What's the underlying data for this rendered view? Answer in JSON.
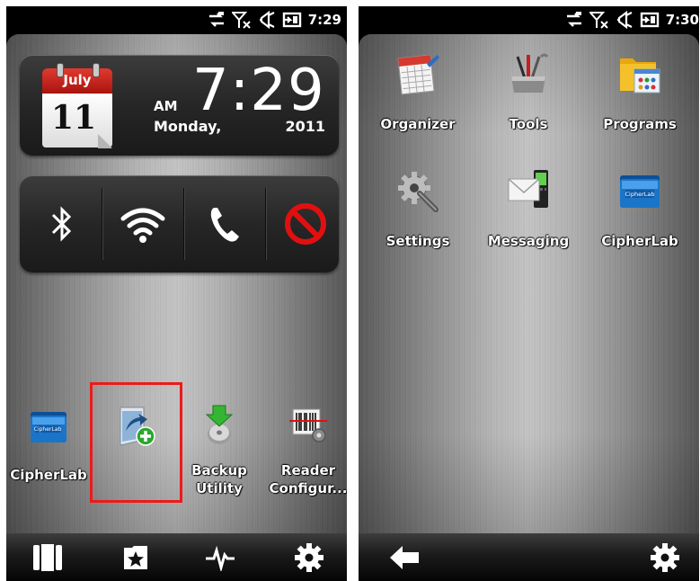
{
  "left_screen": {
    "status": {
      "time": "7:29"
    },
    "clock": {
      "month": "July",
      "day": "11",
      "ampm": "AM",
      "time": "7:29",
      "weekday": "Monday,",
      "year": "2011"
    },
    "connectivity": [
      "bluetooth",
      "wifi",
      "phone",
      "disabled"
    ],
    "apps": [
      {
        "label_line1": "CipherLab",
        "label_line2": "",
        "icon": "cipherlab-folder-icon"
      },
      {
        "label_line1": "",
        "label_line2": "",
        "icon": "add-shortcut-icon"
      },
      {
        "label_line1": "Backup",
        "label_line2": "Utility",
        "icon": "backup-utility-icon"
      },
      {
        "label_line1": "Reader",
        "label_line2": "Configur...",
        "icon": "barcode-reader-icon"
      }
    ],
    "taskbar": [
      "start-tiles-icon",
      "favorites-icon",
      "activity-icon",
      "settings-gear-icon"
    ]
  },
  "right_screen": {
    "status": {
      "time": "7:30"
    },
    "apps": [
      {
        "label": "Organizer",
        "icon": "calendar-organizer-icon"
      },
      {
        "label": "Tools",
        "icon": "tools-icon"
      },
      {
        "label": "Programs",
        "icon": "programs-folder-icon"
      },
      {
        "label": "Settings",
        "icon": "settings-icon"
      },
      {
        "label": "Messaging",
        "icon": "messaging-icon"
      },
      {
        "label": "CipherLab",
        "icon": "cipherlab-folder-icon"
      }
    ],
    "taskbar": [
      "back-arrow-icon",
      "settings-gear-icon"
    ]
  },
  "colors": {
    "highlight": "#ee1a1a",
    "calendar_red": "#d12a22",
    "no_symbol_red": "#e01010"
  },
  "folder_badge": "CipherLab"
}
